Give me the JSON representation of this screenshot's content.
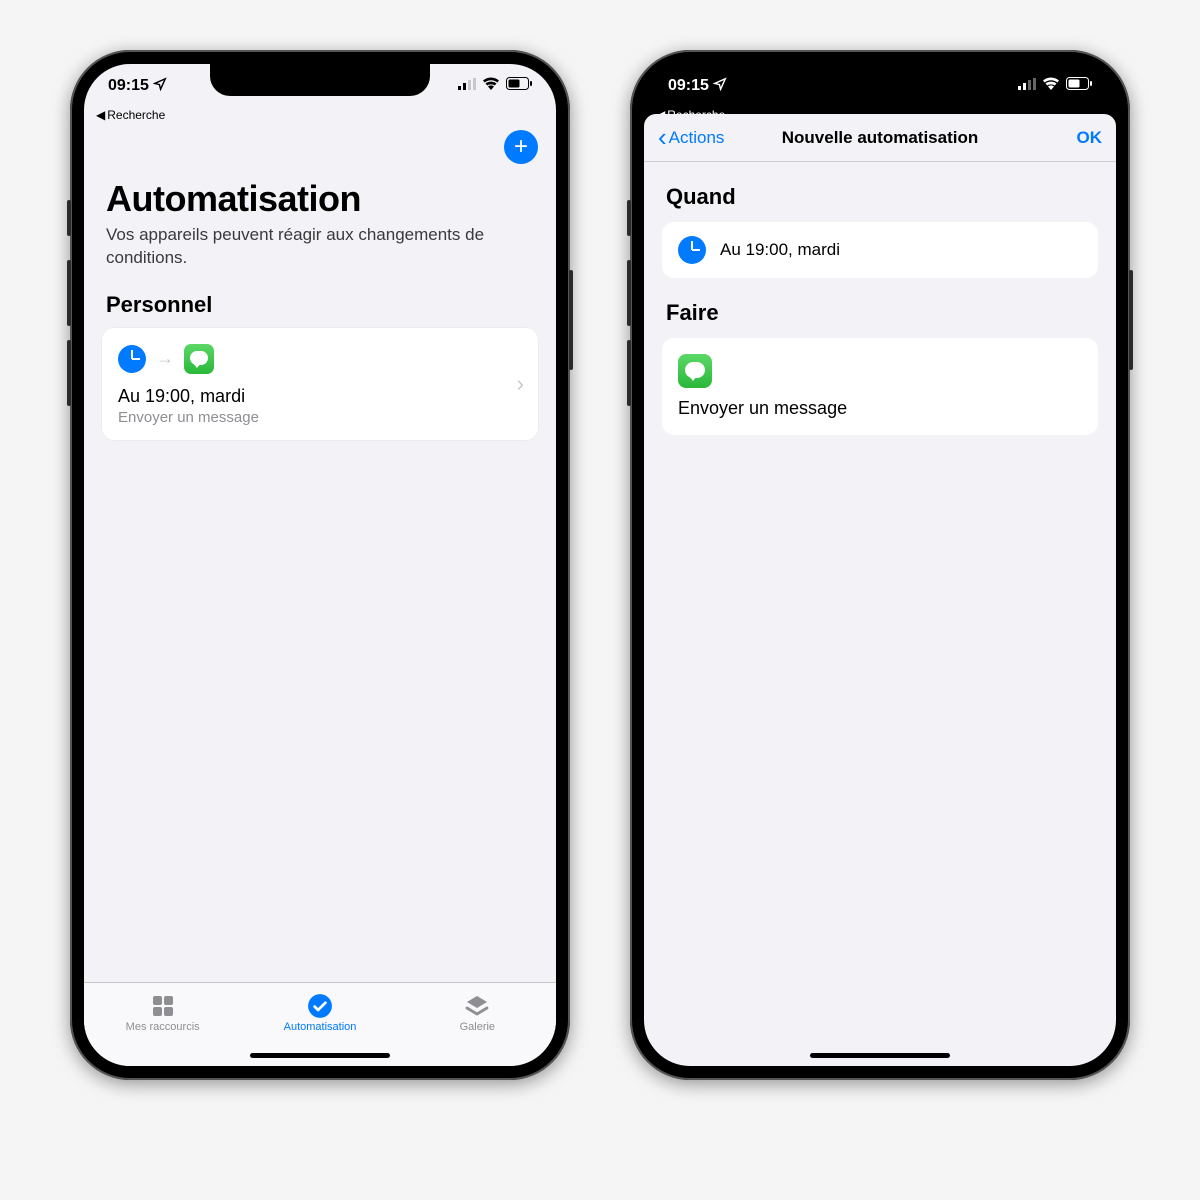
{
  "status": {
    "time": "09:15",
    "breadcrumb": "Recherche"
  },
  "phone1": {
    "title": "Automatisation",
    "subtitle": "Vos appareils peuvent réagir aux changements de conditions.",
    "section": "Personnel",
    "card": {
      "trigger": "Au 19:00, mardi",
      "action": "Envoyer un message"
    },
    "tabs": {
      "shortcuts": "Mes raccourcis",
      "automation": "Automatisation",
      "gallery": "Galerie"
    }
  },
  "phone2": {
    "nav": {
      "back": "Actions",
      "title": "Nouvelle automatisation",
      "ok": "OK"
    },
    "when_label": "Quand",
    "when_value": "Au 19:00, mardi",
    "do_label": "Faire",
    "do_value": "Envoyer un message"
  }
}
